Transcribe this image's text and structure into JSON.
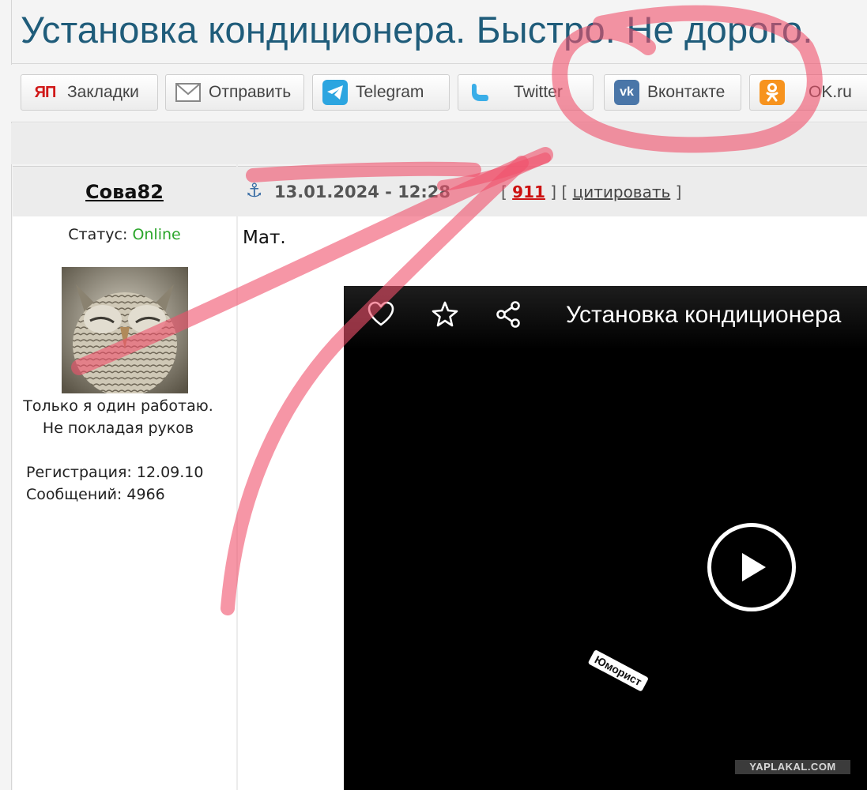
{
  "page_title": "Установка кондиционера. Быстро. Не дорого.",
  "share_buttons": [
    {
      "label": "Закладки",
      "icon": "yap-bookmark-icon"
    },
    {
      "label": "Отправить",
      "icon": "envelope-icon"
    },
    {
      "label": "Telegram",
      "icon": "telegram-icon"
    },
    {
      "label": "Twitter",
      "icon": "twitter-bird-icon"
    },
    {
      "label": "Вконтакте",
      "icon": "vk-icon"
    },
    {
      "label": "OK.ru",
      "icon": "odnoklassniki-icon"
    }
  ],
  "share_icon_text": {
    "yap": "ЯП",
    "vk": "vk"
  },
  "post": {
    "username": "Сова82",
    "datetime": "13.01.2024 - 12:28",
    "bracket_open": "[",
    "bracket_close": "]",
    "bracket_mid": "] [",
    "post_number": "911",
    "quote_link": "цитировать",
    "status_label": "Статус:",
    "status_value": "Online",
    "signature_line1": "Только я один работаю.",
    "signature_line2": "Не покладая руков",
    "registration_label": "Регистрация:",
    "registration_date": "12.09.10",
    "messages_label": "Сообщений:",
    "messages_count": "4966",
    "body": "Мат."
  },
  "video": {
    "title": "Установка кондиционера",
    "watermark": "Юморист"
  },
  "site_watermark": "YAPLAKAL.COM",
  "colors": {
    "title": "#1f5c7a",
    "online": "#2aa52a",
    "post_number": "#cc1111",
    "scribble": "#f0506a"
  }
}
